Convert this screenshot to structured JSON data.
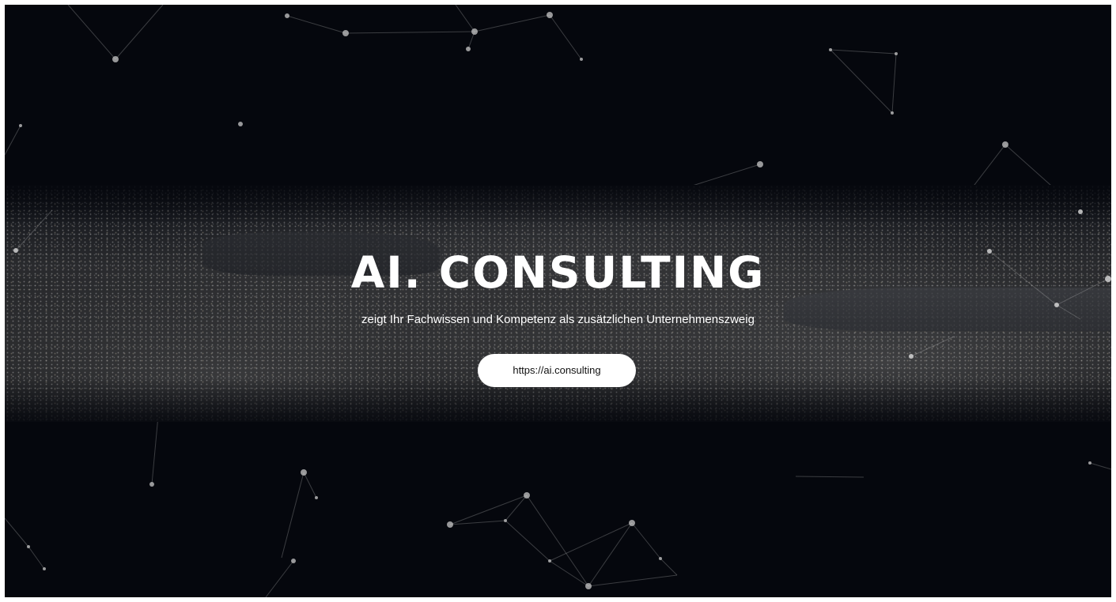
{
  "hero": {
    "title": "AI. CONSULTING",
    "subtitle": "zeigt Ihr Fachwissen und Kompetenz als zusätzlichen Unternehmenszweig",
    "cta_label": "https://ai.consulting"
  },
  "colors": {
    "background": "#05070d",
    "text": "#ffffff",
    "button_background": "#ffffff",
    "button_text": "#111111"
  }
}
